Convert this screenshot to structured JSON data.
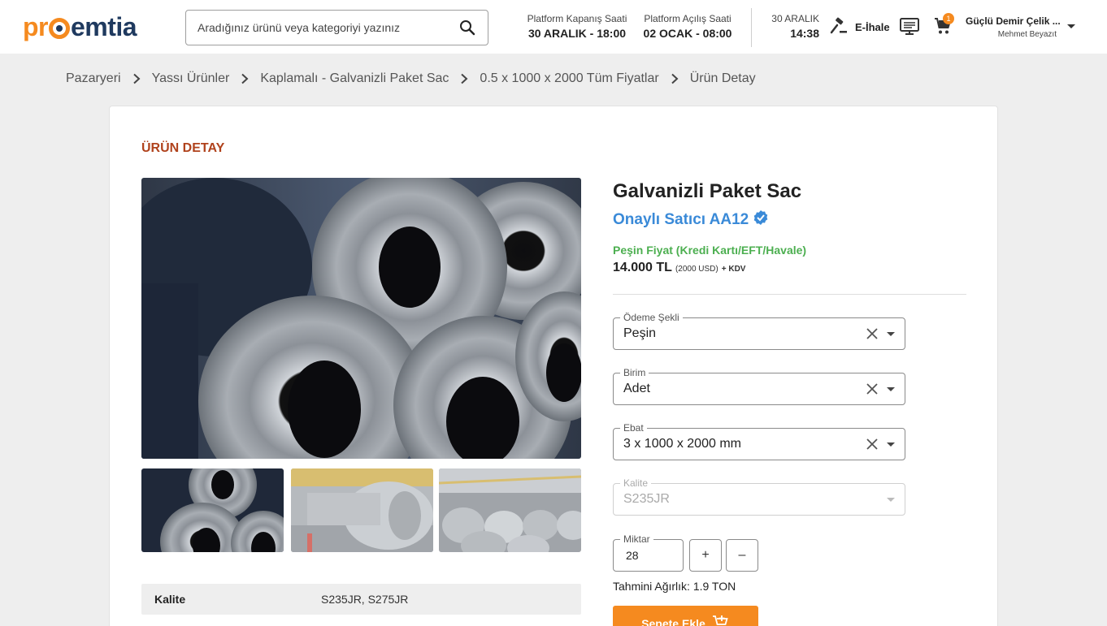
{
  "header": {
    "logo_parts": {
      "a": "pr",
      "b": "emtia"
    },
    "search_placeholder": "Aradığınız ürünü veya kategoriyi yazınız",
    "close_label": "Platform Kapanış Saati",
    "close_value": "30 ARALIK - 18:00",
    "open_label": "Platform Açılış Saati",
    "open_value": "02 OCAK - 08:00",
    "date": "30 ARALIK",
    "time": "14:38",
    "ihale_label": "E-İhale",
    "cart_count": "1",
    "company": "Güçlü Demir Çelik ...",
    "user": "Mehmet Beyazıt"
  },
  "breadcrumb": [
    "Pazaryeri",
    "Yassı Ürünler",
    "Kaplamalı - Galvanizli Paket Sac",
    "0.5 x 1000 x 2000 Tüm Fiyatlar",
    "Ürün Detay"
  ],
  "page": {
    "section_title": "ÜRÜN DETAY",
    "product_title": "Galvanizli Paket Sac",
    "seller": "Onaylı Satıcı AA12",
    "pay_label": "Peşin Fiyat (Kredi Kartı/EFT/Havale)",
    "price_main": "14.000 TL",
    "price_usd": "(2000  USD)",
    "price_kdv": "+ KDV"
  },
  "form": {
    "odeme": {
      "label": "Ödeme Şekli",
      "value": "Peşin"
    },
    "birim": {
      "label": "Birim",
      "value": "Adet"
    },
    "ebat": {
      "label": "Ebat",
      "value": "3 x 1000 x 2000 mm"
    },
    "kalite": {
      "label": "Kalite",
      "value": "S235JR"
    },
    "miktar": {
      "label": "Miktar",
      "value": "28"
    },
    "plus": "+",
    "minus": "–",
    "weight": "Tahmini Ağırlık: 1.9 TON",
    "add_to_cart": "Sepete Ekle"
  },
  "specs": [
    {
      "key": "Kalite",
      "value": "S235JR, S275JR"
    }
  ],
  "colors": {
    "accent": "#f58a1f",
    "navy": "#1f3a5f",
    "title_red": "#b0421c",
    "seller_blue": "#3a8ad8",
    "green": "#4caf50"
  }
}
